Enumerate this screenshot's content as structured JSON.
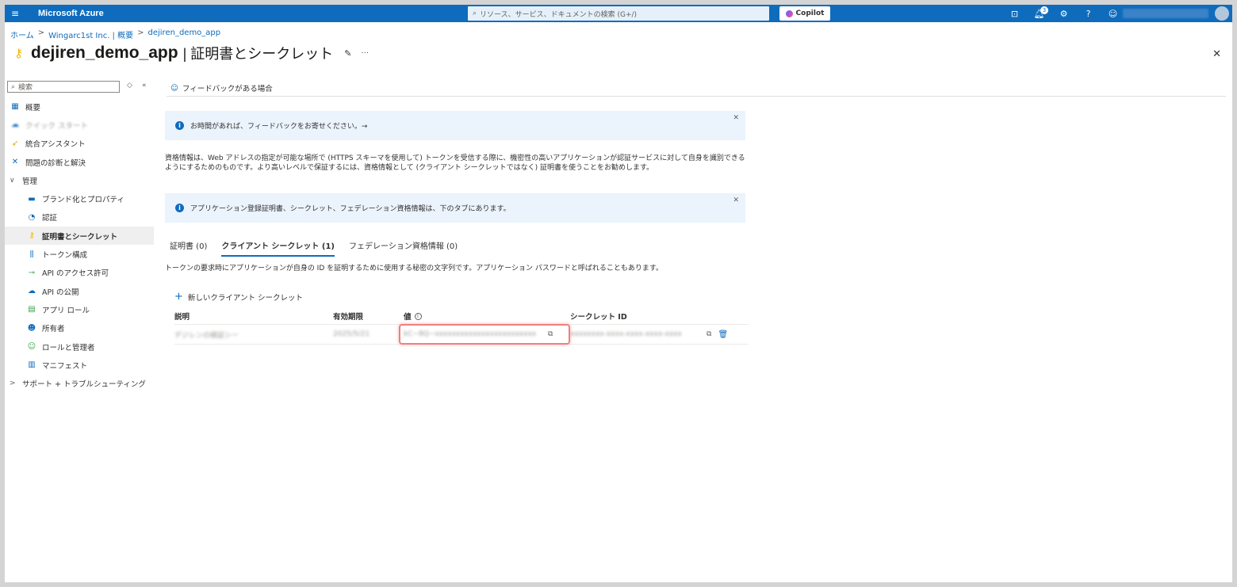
{
  "topbar": {
    "menu_icon": "hamburger-icon",
    "brand": "Microsoft Azure",
    "search_placeholder": "リソース、サービス、ドキュメントの検索 (G+/)",
    "copilot": "Copilot",
    "notification_count": "3"
  },
  "breadcrumb": [
    "ホーム",
    "Wingarc1st Inc. | 概要",
    "dejiren_demo_app"
  ],
  "page": {
    "title": "dejiren_demo_app",
    "subtitle": "| 証明書とシークレット"
  },
  "sidebar": {
    "search_placeholder": "検索",
    "items": [
      {
        "label": "概要",
        "icon": "overview-icon"
      },
      {
        "label": "クイック スタート",
        "icon": "quickstart-icon"
      },
      {
        "label": "統合アシスタント",
        "icon": "rocket-icon"
      },
      {
        "label": "問題の診断と解決",
        "icon": "wrench-icon"
      },
      {
        "label": "管理",
        "icon": "chevron-down-icon"
      },
      {
        "label": "ブランド化とプロパティ",
        "icon": "branding-icon"
      },
      {
        "label": "認証",
        "icon": "auth-icon"
      },
      {
        "label": "証明書とシークレット",
        "icon": "key-icon"
      },
      {
        "label": "トークン構成",
        "icon": "token-icon"
      },
      {
        "label": "API のアクセス許可",
        "icon": "api-permission-icon"
      },
      {
        "label": "API の公開",
        "icon": "cloud-icon"
      },
      {
        "label": "アプリ ロール",
        "icon": "app-roles-icon"
      },
      {
        "label": "所有者",
        "icon": "owners-icon"
      },
      {
        "label": "ロールと管理者",
        "icon": "roles-admin-icon"
      },
      {
        "label": "マニフェスト",
        "icon": "manifest-icon"
      },
      {
        "label": "サポート + トラブルシューティング",
        "icon": "chevron-right-icon"
      }
    ]
  },
  "feedback_label": "フィードバックがある場合",
  "banner1": "お時間があれば、フィードバックをお寄せください。→",
  "description": "資格情報は、Web アドレスの指定が可能な場所で (HTTPS スキーマを使用して) トークンを受信する際に、機密性の高いアプリケーションが認証サービスに対して自身を識別できるようにするためのものです。より高いレベルで保証するには、資格情報として (クライアント シークレットではなく) 証明書を使うことをお勧めします。",
  "banner2": "アプリケーション登録証明書、シークレット、フェデレーション資格情報は、下のタブにあります。",
  "tabs": [
    "証明書 (0)",
    "クライアント シークレット (1)",
    "フェデレーション資格情報 (0)"
  ],
  "tab_description": "トークンの要求時にアプリケーションが自身の ID を証明するために使用する秘密の文字列です。アプリケーション パスワードと呼ばれることもあります。",
  "new_secret_label": "新しいクライアント シークレット",
  "table": {
    "headers": [
      "説明",
      "有効期限",
      "値",
      "シークレット ID"
    ],
    "row": {
      "description": "デジレンの検証シー",
      "expires": "2025/5/21",
      "value": "kC~8Q~xxxxxxxxxxxxxxxxxxxxxxxx",
      "secret_id": "xxxxxxxx-xxxx-xxxx-xxxx-xxxx"
    }
  }
}
